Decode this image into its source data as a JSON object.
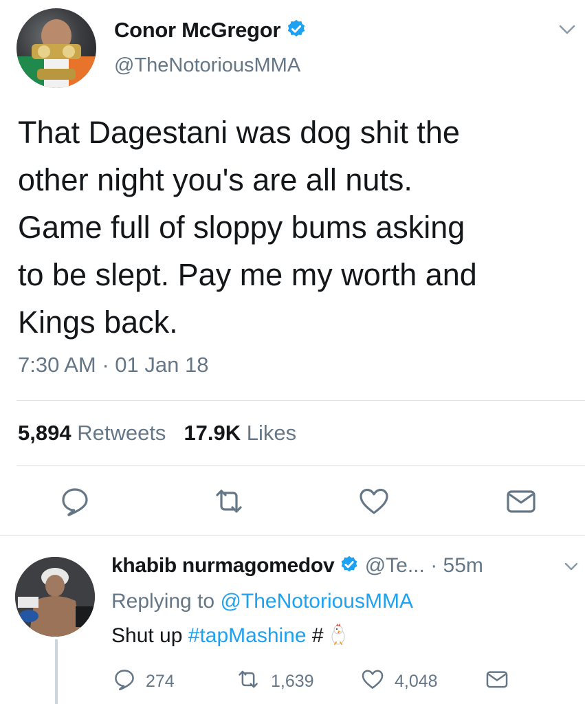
{
  "tweet": {
    "author_name": "Conor McGregor",
    "author_handle": "@TheNotoriousMMA",
    "text": "That Dagestani was dog shit the\nother night you's are all nuts.\nGame full of sloppy bums asking\nto be slept. Pay me my worth and\nKings back.",
    "timestamp": "7:30 AM · 01 Jan 18",
    "retweets_count": "5,894",
    "retweets_label": "Retweets",
    "likes_count": "17.9K",
    "likes_label": "Likes"
  },
  "reply": {
    "author_name": "khabib nurmagomedov",
    "author_handle": "@Te...",
    "time": "· 55m",
    "replying_prefix": "Replying to",
    "replying_to": "@TheNotoriousMMA",
    "text_prefix": "Shut up",
    "hashtag": "#tapMashine",
    "hashtag2": "#",
    "replies_count": "274",
    "retweets_count": "1,639",
    "likes_count": "4,048"
  },
  "colors": {
    "text": "#14171a",
    "secondary": "#657786",
    "link": "#1da1f2",
    "verified": "#1da1f2",
    "divider": "#dfe3e6"
  },
  "icons": {
    "verified": "verified-badge-icon",
    "chevron": "chevron-down-icon",
    "reply": "reply-bubble-icon",
    "retweet": "retweet-icon",
    "like": "heart-icon",
    "share": "envelope-icon"
  }
}
